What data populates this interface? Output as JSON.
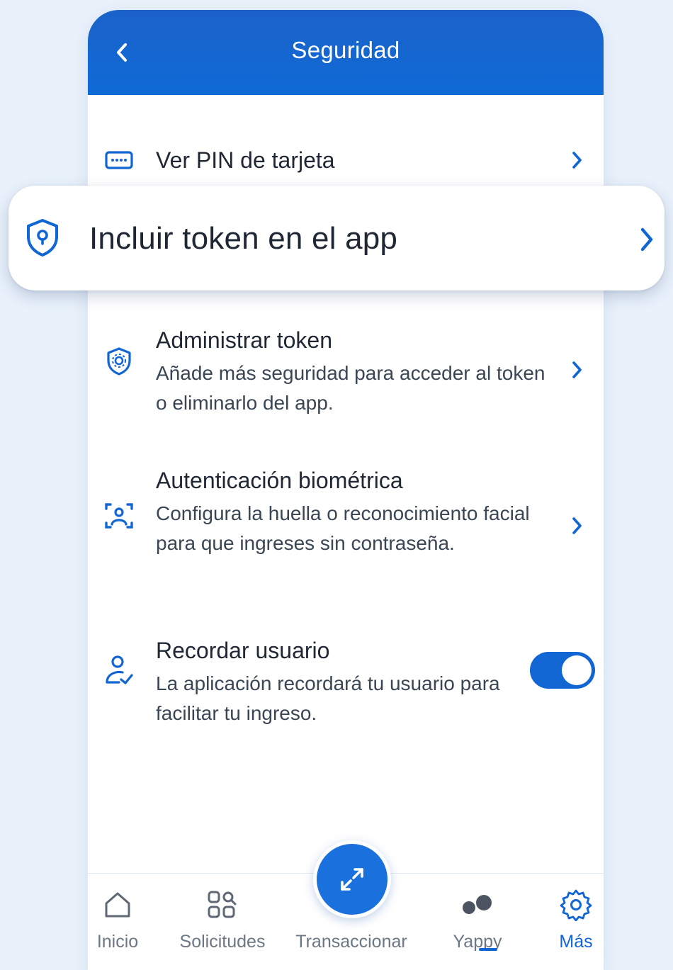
{
  "header": {
    "title": "Seguridad",
    "back_icon": "chevron-left-icon"
  },
  "menu": {
    "ver_pin": {
      "title": "Ver PIN de tarjeta",
      "icon": "card-pin-icon"
    },
    "incluir_token": {
      "title": "Incluir token en el app",
      "icon": "shield-keyhole-icon"
    },
    "administrar_token": {
      "title": "Administrar token",
      "description": "Añade más seguridad para acceder al token o eliminarlo del app.",
      "icon": "shield-gear-icon"
    },
    "biometria": {
      "title": "Autenticación biométrica",
      "description": "Configura la huella o reconocimiento facial para que ingreses sin contraseña.",
      "icon": "face-scan-icon"
    },
    "recordar_usuario": {
      "title": "Recordar usuario",
      "description": "La aplicación recordará tu usuario para facilitar tu ingreso.",
      "icon": "user-check-icon",
      "enabled": true
    }
  },
  "nav": {
    "items": [
      {
        "label": "Inicio",
        "icon": "home-icon"
      },
      {
        "label": "Solicitudes",
        "icon": "grid-search-icon"
      },
      {
        "label": "Transaccionar",
        "icon": "transfer-arrows-icon"
      },
      {
        "label": "Yappy",
        "icon": "yappy-dots-icon"
      },
      {
        "label": "Más",
        "icon": "gear-icon",
        "active": true
      }
    ]
  },
  "colors": {
    "primary": "#1266d4",
    "header": "#1b62c9",
    "background": "#e9f1fb",
    "text": "#1e2733",
    "muted": "#6c7784"
  }
}
